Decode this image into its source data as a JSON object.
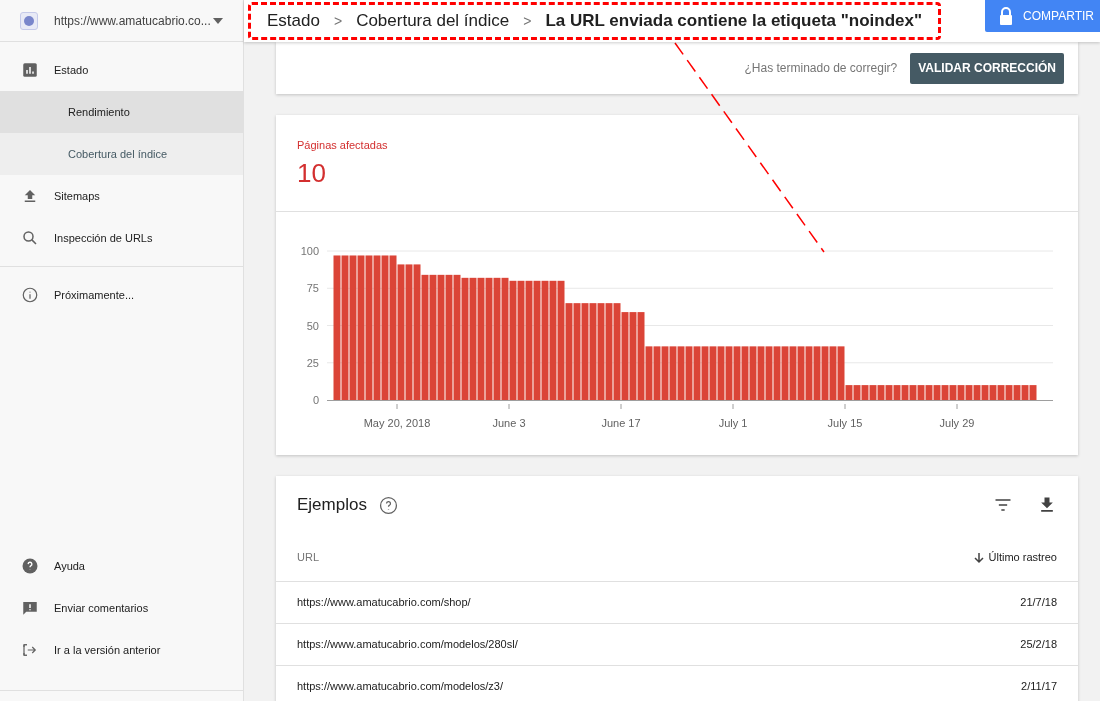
{
  "property_selector": {
    "url": "https://www.amatucabrio.co..."
  },
  "breadcrumb": [
    {
      "label": "Estado",
      "current": false
    },
    {
      "label": "Cobertura del índice",
      "current": false
    },
    {
      "label": "La URL enviada contiene la etiqueta \"noindex\"",
      "current": true
    }
  ],
  "breadcrumb_separator": ">",
  "share_button": "COMPARTIR",
  "sidebar": {
    "items": [
      {
        "label": "Estado",
        "kind": "section",
        "selected": false,
        "hovered": false
      },
      {
        "label": "Rendimiento",
        "kind": "sub",
        "selected": false,
        "hovered": true
      },
      {
        "label": "Cobertura del índice",
        "kind": "sub",
        "selected": true,
        "hovered": false
      },
      {
        "label": "Sitemaps",
        "kind": "section",
        "selected": false,
        "hovered": false
      },
      {
        "label": "Inspección de URLs",
        "kind": "section",
        "selected": false,
        "hovered": false
      },
      {
        "label": "Próximamente...",
        "kind": "section",
        "selected": false,
        "hovered": false
      }
    ],
    "footer_items": [
      {
        "label": "Ayuda"
      },
      {
        "label": "Enviar comentarios"
      },
      {
        "label": "Ir a la versión anterior"
      }
    ]
  },
  "validation": {
    "question": "¿Has terminado de corregir?",
    "button": "VALIDAR CORRECCIÓN"
  },
  "summary": {
    "label": "Páginas afectadas",
    "value": "10",
    "chart_data": {
      "type": "bar",
      "categories": [
        null,
        null,
        null,
        null,
        null,
        null,
        null,
        null,
        "May 20, 2018",
        null,
        null,
        null,
        null,
        null,
        null,
        null,
        null,
        null,
        null,
        null,
        null,
        null,
        "June 3",
        null,
        null,
        null,
        null,
        null,
        null,
        null,
        null,
        null,
        null,
        null,
        null,
        null,
        "June 17",
        null,
        null,
        null,
        null,
        null,
        null,
        null,
        null,
        null,
        null,
        null,
        null,
        null,
        "July 1",
        null,
        null,
        null,
        null,
        null,
        null,
        null,
        null,
        null,
        null,
        null,
        null,
        null,
        "July 15",
        null,
        null,
        null,
        null,
        null,
        null,
        null,
        null,
        null,
        null,
        null,
        null,
        null,
        "July 29",
        null,
        null,
        null,
        null,
        null,
        null,
        null,
        null,
        null
      ],
      "series": [
        {
          "color": "#db4437",
          "values": [
            97,
            97,
            97,
            97,
            97,
            97,
            97,
            97,
            91,
            91,
            91,
            84,
            84,
            84,
            84,
            84,
            82,
            82,
            82,
            82,
            82,
            82,
            80,
            80,
            80,
            80,
            80,
            80,
            80,
            65,
            65,
            65,
            65,
            65,
            65,
            65,
            59,
            59,
            59,
            36,
            36,
            36,
            36,
            36,
            36,
            36,
            36,
            36,
            36,
            36,
            36,
            36,
            36,
            36,
            36,
            36,
            36,
            36,
            36,
            36,
            36,
            36,
            36,
            36,
            10,
            10,
            10,
            10,
            10,
            10,
            10,
            10,
            10,
            10,
            10,
            10,
            10,
            10,
            10,
            10,
            10,
            10,
            10,
            10,
            10,
            10,
            10,
            10
          ]
        }
      ],
      "ylim": [
        0,
        100
      ],
      "yticks": [
        0,
        25,
        50,
        75,
        100
      ],
      "grid": true
    }
  },
  "examples": {
    "title": "Ejemplos",
    "columns": [
      {
        "label": "URL",
        "sorted": false
      },
      {
        "label": "Último rastreo",
        "sorted": true
      }
    ],
    "rows": [
      [
        "https://www.amatucabrio.com/shop/",
        "21/7/18"
      ],
      [
        "https://www.amatucabrio.com/modelos/280sl/",
        "25/2/18"
      ],
      [
        "https://www.amatucabrio.com/modelos/z3/",
        "2/11/17"
      ]
    ]
  }
}
